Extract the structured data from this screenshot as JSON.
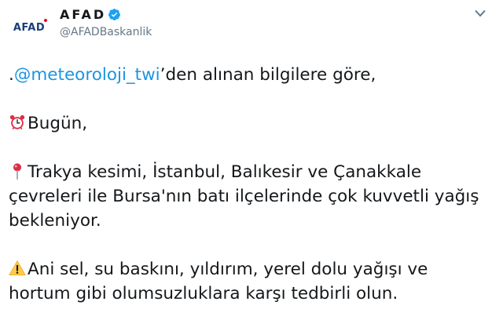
{
  "account": {
    "avatar_text": "AFAD",
    "display_name": "AFAD",
    "handle": "@AFADBaskanlik",
    "verified": true
  },
  "tweet": {
    "intro_prefix": ".",
    "mention": "@meteoroloji_twi",
    "intro_suffix": "’den alınan bilgilere göre,",
    "today": "Bugün,",
    "warning_line1": "Trakya kesimi, İstanbul, Balıkesir ve Çanakkale",
    "warning_line2": "çevreleri ile Bursa'nın batı ilçelerinde çok kuvvetli yağış",
    "warning_line3": "bekleniyor.",
    "caution_line1": "Ani sel, su baskını, yıldırım, yerel dolu yağışı ve",
    "caution_line2": "hortum gibi olumsuzluklara karşı tedbirli olun."
  },
  "icons": {
    "verified": "verified-badge-icon",
    "menu": "chevron-down-icon",
    "alarm": "alarm-clock-icon",
    "pin": "round-pushpin-icon",
    "warning": "warning-sign-icon"
  },
  "colors": {
    "link": "#1b95e0",
    "text": "#14171a",
    "secondary": "#657786",
    "verified": "#1da1f2",
    "brand": "#1a3d7c"
  }
}
